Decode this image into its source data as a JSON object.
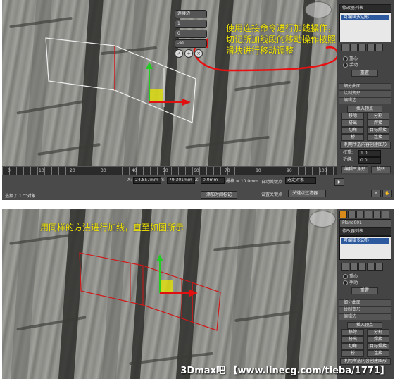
{
  "screenshot_1": {
    "annotation": "使用连接命令进行加线操作，切记所加线段的移动操作按照滑块进行移动调整",
    "caddy": {
      "title": "连接边",
      "field_1": "1",
      "field_2": "0",
      "field_3": "-91"
    },
    "command_panel": {
      "modifier_list": "修改器列表",
      "stack_item": "可编辑多边形",
      "soft_selection": {
        "option_1": "重心",
        "option_2": "手动",
        "button": "重置"
      },
      "rollouts": {
        "subdivision_surface": "细分曲面",
        "paint_deform": "绘制变形",
        "edit_edges": "编辑边"
      },
      "edit_edges": {
        "insert_vertex": "插入顶点",
        "remove": "移除",
        "split": "分割",
        "extrude": "挤出",
        "weld": "焊接",
        "chamfer": "切角",
        "target_weld": "目标焊接",
        "bridge": "桥",
        "connect": "连接",
        "create_shape": "利用所选内容创建图形",
        "weight_label": "权重:",
        "weight_value": "1.0",
        "crease_label": "折缝:",
        "crease_value": "0.0",
        "edit_tri": "编辑三角形",
        "turn": "旋转"
      }
    },
    "timeline_ticks": [
      "0",
      "10",
      "20",
      "30",
      "40",
      "50",
      "60",
      "70",
      "80",
      "90",
      "100"
    ],
    "status_bar": {
      "selection": "选择了 1 个对象",
      "add_time_tag": "添加时间标记",
      "x_label": "X:",
      "x_value": "24.857mm",
      "y_label": "Y:",
      "y_value": "79.301mm",
      "z_label": "Z:",
      "z_value": "0.0mm",
      "grid": "栅格 = 10.0mm",
      "auto_key": "自动关键点",
      "selected_dropdown": "选定对象",
      "set_key": "设置关键点",
      "key_filters": "关键点过滤器..."
    }
  },
  "screenshot_2": {
    "annotation": "用同样的方法进行加线，直至如图所示",
    "command_panel": {
      "object_name": "Plane001",
      "modifier_list": "修改器列表",
      "stack_item": "可编辑多边形",
      "soft_selection": {
        "option_1": "重心",
        "option_2": "手动",
        "button": "重置"
      },
      "rollouts": {
        "subdivision_surface": "细分曲面",
        "paint_deform": "绘制变形",
        "edit_edges": "编辑边"
      },
      "edit_edges": {
        "insert_vertex": "插入顶点",
        "remove": "移除",
        "split": "分割",
        "extrude": "挤出",
        "weld": "焊接",
        "chamfer": "切角",
        "target_weld": "目标焊接",
        "bridge": "桥",
        "connect": "连接",
        "create_shape": "利用所选内容创建图形"
      }
    },
    "watermark": "3Dmax吧 【www.linecg.com/tieba/1771】"
  },
  "colors": {
    "annotation_text": "#f2e600",
    "red_arrow": "#e81010",
    "selected_edge": "#d01818",
    "gizmo_y": "#22cc22",
    "gizmo_x": "#e01010",
    "gizmo_plane": "#e6e600"
  }
}
